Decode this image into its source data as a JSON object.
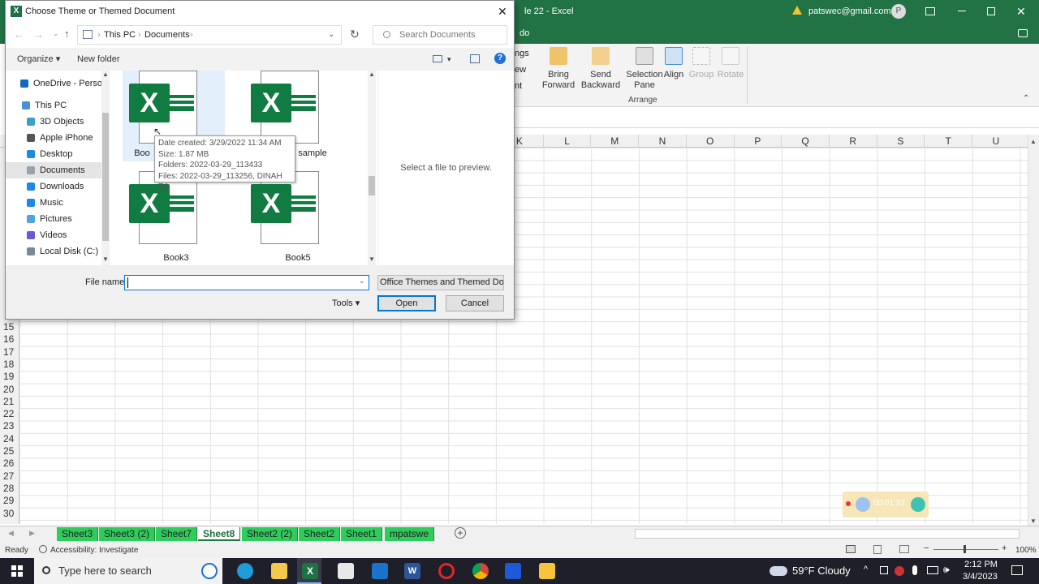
{
  "excel": {
    "title": "le 22 - Excel",
    "account": "patswec@gmail.com",
    "account_initial": "P",
    "tell_me": "do",
    "ribbon": {
      "partial_labels": [
        "ngs",
        "ew",
        "nt"
      ],
      "buttons": [
        {
          "label": "Bring",
          "label2": "Forward"
        },
        {
          "label": "Send",
          "label2": "Backward"
        },
        {
          "label": "Selection",
          "label2": "Pane"
        },
        {
          "label": "Align",
          "label2": ""
        },
        {
          "label": "Group",
          "label2": ""
        },
        {
          "label": "Rotate",
          "label2": ""
        }
      ],
      "group_name": "Arrange"
    },
    "columns": [
      "K",
      "L",
      "M",
      "N",
      "O",
      "P",
      "Q",
      "R",
      "S",
      "T",
      "U"
    ],
    "rows": [
      "15",
      "16",
      "17",
      "18",
      "19",
      "20",
      "21",
      "22",
      "23",
      "24",
      "25",
      "26",
      "27",
      "28",
      "29",
      "30"
    ],
    "sheets": [
      "Sheet3",
      "Sheet3 (2)",
      "Sheet7",
      "Sheet8",
      "Sheet2 (2)",
      "Sheet2",
      "Sheet1",
      "mpatswe"
    ],
    "active_sheet": "Sheet8",
    "status": {
      "ready": "Ready",
      "accessibility": "Accessibility: Investigate",
      "zoom": "100%"
    },
    "recorder_time": "00:01:22"
  },
  "dialog": {
    "title": "Choose Theme or Themed Document",
    "breadcrumb": [
      "This PC",
      "Documents"
    ],
    "search_placeholder": "Search Documents",
    "organize": "Organize",
    "new_folder": "New folder",
    "nav": [
      {
        "label": "OneDrive - Person",
        "color": "#0f6cbd"
      },
      {
        "label": "This PC",
        "color": "#4a90d9"
      },
      {
        "label": "3D Objects",
        "color": "#3aa0c8"
      },
      {
        "label": "Apple iPhone",
        "color": "#555555"
      },
      {
        "label": "Desktop",
        "color": "#1e88e5"
      },
      {
        "label": "Documents",
        "color": "#9aa3ad"
      },
      {
        "label": "Downloads",
        "color": "#1e88e5"
      },
      {
        "label": "Music",
        "color": "#1e88e5"
      },
      {
        "label": "Pictures",
        "color": "#4fa3e0"
      },
      {
        "label": "Videos",
        "color": "#6a5acd"
      },
      {
        "label": "Local Disk (C:)",
        "color": "#7a8a99"
      }
    ],
    "files": [
      {
        "name": "Boo",
        "icon": "excel-file-icon"
      },
      {
        "name": "sample",
        "icon": "excel-file-icon"
      },
      {
        "name": "Book3",
        "icon": "excel-file-icon"
      },
      {
        "name": "Book5",
        "icon": "excel-file-icon"
      }
    ],
    "tooltip": {
      "date_created": "Date created: 3/29/2022 11:34 AM",
      "size": "Size: 1.87 MB",
      "folders": "Folders: 2022-03-29_113433",
      "files": "Files: 2022-03-29_113256, DINAH EA"
    },
    "preview_text": "Select a file to preview.",
    "file_name_label": "File name:",
    "file_name_value": "",
    "filter": "Office Themes and Themed Do",
    "tools": "Tools",
    "open": "Open",
    "cancel": "Cancel"
  },
  "taskbar": {
    "search": "Type here to search",
    "weather": "59°F  Cloudy",
    "time": "2:12 PM",
    "date": "3/4/2023"
  }
}
